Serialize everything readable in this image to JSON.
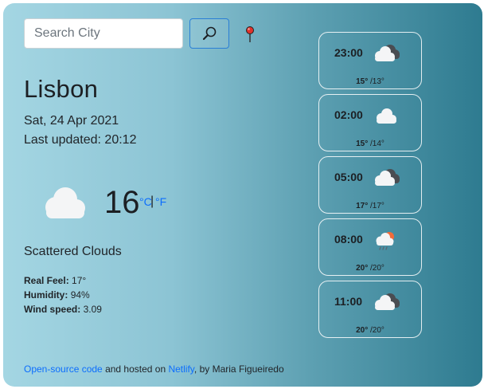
{
  "search": {
    "placeholder": "Search City",
    "value": ""
  },
  "icons": {
    "search": "magnifier-icon",
    "location": "location-pin-icon",
    "main": "cloud-icon",
    "broken_clouds": "broken-clouds-icon",
    "cloud": "cloud-icon",
    "rain": "sun-cloud-rain-icon"
  },
  "current": {
    "city": "Lisbon",
    "date": "Sat, 24 Apr 2021",
    "updated_label": "Last updated:",
    "updated_time": "20:12",
    "temperature": "16",
    "unit_c": "°C",
    "unit_sep": "|",
    "unit_f": "°F",
    "description": "Scattered Clouds",
    "real_feel_label": "Real Feel:",
    "real_feel": "17°",
    "humidity_label": "Humidity:",
    "humidity": "94%",
    "wind_label": "Wind speed:",
    "wind": "3.09"
  },
  "forecast": [
    {
      "time": "23:00",
      "icon": "broken-clouds-icon",
      "max": "15°",
      "min": "/13°"
    },
    {
      "time": "02:00",
      "icon": "cloud-icon",
      "max": "15°",
      "min": "/14°"
    },
    {
      "time": "05:00",
      "icon": "broken-clouds-icon",
      "max": "17°",
      "min": "/17°"
    },
    {
      "time": "08:00",
      "icon": "sun-cloud-rain-icon",
      "max": "20°",
      "min": "/20°"
    },
    {
      "time": "11:00",
      "icon": "broken-clouds-icon",
      "max": "20°",
      "min": "/20°"
    }
  ],
  "footer": {
    "code_link": "Open-source code",
    "middle": " and hosted on ",
    "host_link": "Netlify",
    "end": ", by Maria Figueiredo"
  },
  "colors": {
    "link": "#0d6efd",
    "gradient_start": "#a4d6e3",
    "gradient_end": "#2e7b90"
  }
}
